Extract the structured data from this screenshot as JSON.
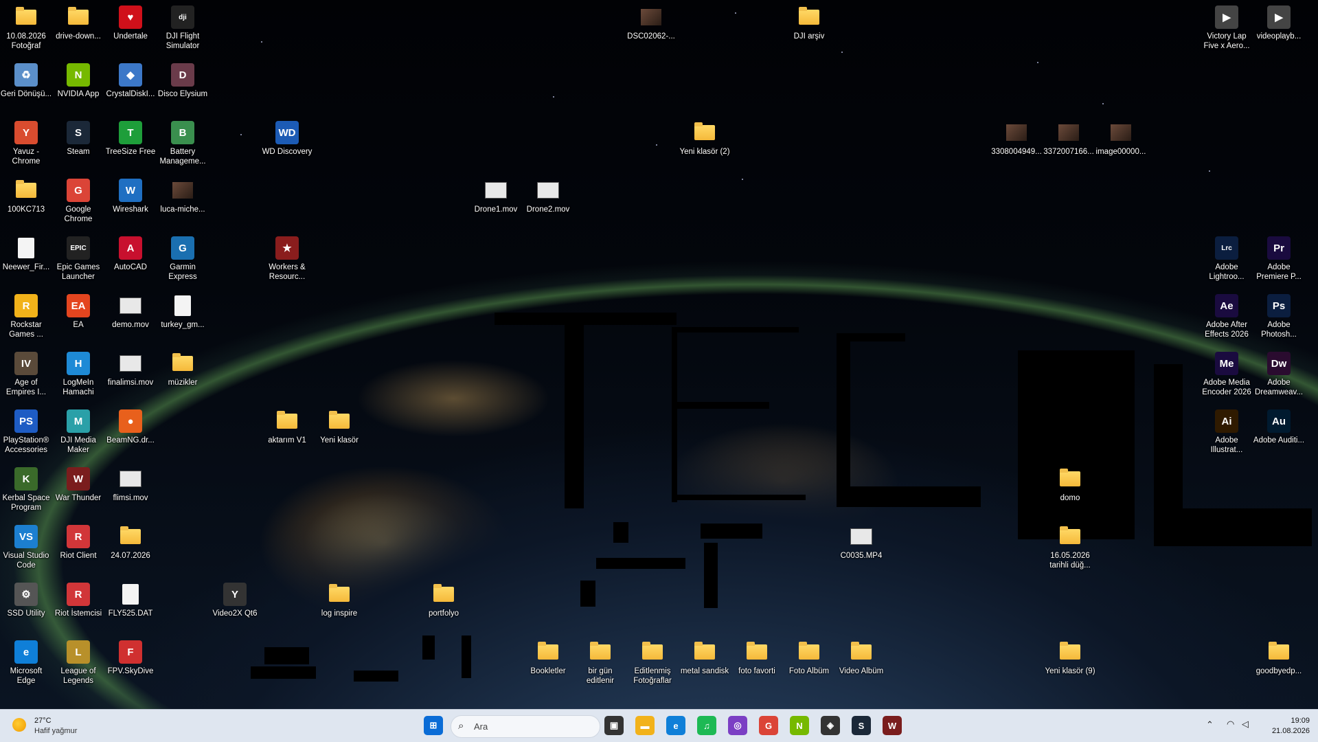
{
  "desktop_icons": [
    {
      "label": "10.08.2026 Fotoğraf",
      "kind": "folder"
    },
    {
      "label": "drive-down...",
      "kind": "folder"
    },
    {
      "label": "Undertale",
      "kind": "app",
      "glyph": "♥",
      "color": "#d0101a"
    },
    {
      "label": "DJI Flight Simulator",
      "kind": "app",
      "glyph": "dji",
      "color": "#222"
    },
    {
      "label": "DSC02062-...",
      "kind": "image"
    },
    {
      "label": "DJI arşiv",
      "kind": "folder"
    },
    {
      "label": "Victory Lap Five x Aero...",
      "kind": "app",
      "glyph": "▶",
      "color": "#444"
    },
    {
      "label": "videoplayb...",
      "kind": "app",
      "glyph": "▶",
      "color": "#444"
    },
    {
      "label": "Geri Dönüşü...",
      "kind": "app",
      "glyph": "♻",
      "color": "#5b8fc9"
    },
    {
      "label": "NVIDIA App",
      "kind": "app",
      "glyph": "N",
      "color": "#76b900"
    },
    {
      "label": "CrystalDiskI...",
      "kind": "app",
      "glyph": "◆",
      "color": "#3c78c8"
    },
    {
      "label": "Disco Elysium",
      "kind": "app",
      "glyph": "D",
      "color": "#6a3b4a"
    },
    {
      "label": "Yavuz - Chrome",
      "kind": "app",
      "glyph": "Y",
      "color": "#d94c2f"
    },
    {
      "label": "Steam",
      "kind": "app",
      "glyph": "S",
      "color": "#1b2838"
    },
    {
      "label": "TreeSize Free",
      "kind": "app",
      "glyph": "T",
      "color": "#1e9e3a"
    },
    {
      "label": "Battery Manageme...",
      "kind": "app",
      "glyph": "B",
      "color": "#3a8f4e"
    },
    {
      "label": "WD Discovery",
      "kind": "app",
      "glyph": "WD",
      "color": "#1c5bb5"
    },
    {
      "label": "Yeni klasör (2)",
      "kind": "folder"
    },
    {
      "label": "3308004949...",
      "kind": "image"
    },
    {
      "label": "3372007166...",
      "kind": "image"
    },
    {
      "label": "image00000...",
      "kind": "image"
    },
    {
      "label": "100KC713",
      "kind": "folder"
    },
    {
      "label": "Google Chrome",
      "kind": "app",
      "glyph": "G",
      "color": "#db4437"
    },
    {
      "label": "Wireshark",
      "kind": "app",
      "glyph": "W",
      "color": "#1f6fc2"
    },
    {
      "label": "luca-miche...",
      "kind": "image"
    },
    {
      "label": "Drone1.mov",
      "kind": "video"
    },
    {
      "label": "Drone2.mov",
      "kind": "video"
    },
    {
      "label": "Neewer_Fir...",
      "kind": "file"
    },
    {
      "label": "Epic Games Launcher",
      "kind": "app",
      "glyph": "EPIC",
      "color": "#222"
    },
    {
      "label": "AutoCAD",
      "kind": "app",
      "glyph": "A",
      "color": "#c8102e"
    },
    {
      "label": "Garmin Express",
      "kind": "app",
      "glyph": "G",
      "color": "#1a6fb0"
    },
    {
      "label": "Workers & Resourc...",
      "kind": "app",
      "glyph": "★",
      "color": "#8a1d1d"
    },
    {
      "label": "Adobe Lightroo...",
      "kind": "app",
      "glyph": "Lrc",
      "color": "#0b1e3f"
    },
    {
      "label": "Adobe Premiere P...",
      "kind": "app",
      "glyph": "Pr",
      "color": "#1a0b3f"
    },
    {
      "label": "Rockstar Games ...",
      "kind": "app",
      "glyph": "R",
      "color": "#f2b21a"
    },
    {
      "label": "EA",
      "kind": "app",
      "glyph": "EA",
      "color": "#e4451f"
    },
    {
      "label": "demo.mov",
      "kind": "video"
    },
    {
      "label": "turkey_gm...",
      "kind": "file"
    },
    {
      "label": "Adobe After Effects 2026",
      "kind": "app",
      "glyph": "Ae",
      "color": "#1a0b3f"
    },
    {
      "label": "Adobe Photosh...",
      "kind": "app",
      "glyph": "Ps",
      "color": "#0b1e3f"
    },
    {
      "label": "Age of Empires I...",
      "kind": "app",
      "glyph": "IV",
      "color": "#5a4a3a"
    },
    {
      "label": "LogMeIn Hamachi",
      "kind": "app",
      "glyph": "H",
      "color": "#1e8ad6"
    },
    {
      "label": "finalimsi.mov",
      "kind": "video"
    },
    {
      "label": "müzikler",
      "kind": "folder"
    },
    {
      "label": "Adobe Media Encoder 2026",
      "kind": "app",
      "glyph": "Me",
      "color": "#1a0b3f"
    },
    {
      "label": "Adobe Dreamweav...",
      "kind": "app",
      "glyph": "Dw",
      "color": "#2a0b2f"
    },
    {
      "label": "PlayStation® Accessories",
      "kind": "app",
      "glyph": "PS",
      "color": "#1e5cc4"
    },
    {
      "label": "DJI Media Maker",
      "kind": "app",
      "glyph": "M",
      "color": "#2aa0a8"
    },
    {
      "label": "BeamNG.dr...",
      "kind": "app",
      "glyph": "●",
      "color": "#e8601c"
    },
    {
      "label": "aktarım V1",
      "kind": "folder"
    },
    {
      "label": "Yeni klasör",
      "kind": "folder"
    },
    {
      "label": "Adobe Illustrat...",
      "kind": "app",
      "glyph": "Ai",
      "color": "#2f1a00"
    },
    {
      "label": "Adobe Auditi...",
      "kind": "app",
      "glyph": "Au",
      "color": "#001a2f"
    },
    {
      "label": "Kerbal Space Program",
      "kind": "app",
      "glyph": "K",
      "color": "#3a6a2a"
    },
    {
      "label": "War Thunder",
      "kind": "app",
      "glyph": "W",
      "color": "#7a1d1d"
    },
    {
      "label": "flimsi.mov",
      "kind": "video"
    },
    {
      "label": "domo",
      "kind": "folder"
    },
    {
      "label": "Visual Studio Code",
      "kind": "app",
      "glyph": "VS",
      "color": "#1c7fd0"
    },
    {
      "label": "Riot Client",
      "kind": "app",
      "glyph": "R",
      "color": "#d13639"
    },
    {
      "label": "24.07.2026",
      "kind": "folder"
    },
    {
      "label": "C0035.MP4",
      "kind": "video"
    },
    {
      "label": "16.05.2026 tarihli düğ...",
      "kind": "folder"
    },
    {
      "label": "SSD Utility",
      "kind": "app",
      "glyph": "⚙",
      "color": "#555"
    },
    {
      "label": "Riot İstemcisi",
      "kind": "app",
      "glyph": "R",
      "color": "#d13639"
    },
    {
      "label": "FLY525.DAT",
      "kind": "file"
    },
    {
      "label": "Video2X Qt6",
      "kind": "app",
      "glyph": "Y",
      "color": "#333"
    },
    {
      "label": "log inspire",
      "kind": "folder"
    },
    {
      "label": "portfolyo",
      "kind": "folder"
    },
    {
      "label": "Microsoft Edge",
      "kind": "app",
      "glyph": "e",
      "color": "#0f7fd8"
    },
    {
      "label": "League of Legends",
      "kind": "app",
      "glyph": "L",
      "color": "#b8902a"
    },
    {
      "label": "FPV.SkyDive",
      "kind": "app",
      "glyph": "F",
      "color": "#d03030"
    },
    {
      "label": "Bookletler",
      "kind": "folder"
    },
    {
      "label": "bir gün editlenir",
      "kind": "folder"
    },
    {
      "label": "Editlenmiş Fotoğraflar",
      "kind": "folder"
    },
    {
      "label": "metal sandisk",
      "kind": "folder"
    },
    {
      "label": "foto favorti",
      "kind": "folder"
    },
    {
      "label": "Foto Albüm",
      "kind": "folder"
    },
    {
      "label": "Video Albüm",
      "kind": "folder"
    },
    {
      "label": "Yeni klasör (9)",
      "kind": "folder"
    },
    {
      "label": "goodbyedp...",
      "kind": "folder"
    }
  ],
  "taskbar": {
    "weather": {
      "temp": "27°C",
      "desc": "Hafif yağmur"
    },
    "search_placeholder": "Ara",
    "clock": {
      "time": "19:09",
      "date": "21.08.2026"
    },
    "apps": [
      {
        "name": "start-button",
        "glyph": "⊞",
        "color": "#0a6cd6"
      },
      {
        "name": "task-view-button",
        "glyph": "▣",
        "color": "#333"
      },
      {
        "name": "file-explorer-button",
        "glyph": "▬",
        "color": "#f2b21a"
      },
      {
        "name": "edge-button",
        "glyph": "e",
        "color": "#0f7fd8"
      },
      {
        "name": "spotify-button",
        "glyph": "♫",
        "color": "#1db954"
      },
      {
        "name": "podcast-button",
        "glyph": "◎",
        "color": "#7b3fc4"
      },
      {
        "name": "chrome-button",
        "glyph": "G",
        "color": "#db4437"
      },
      {
        "name": "nvidia-button",
        "glyph": "N",
        "color": "#76b900"
      },
      {
        "name": "davinci-button",
        "glyph": "◈",
        "color": "#333"
      },
      {
        "name": "steam-button",
        "glyph": "S",
        "color": "#1b2838"
      },
      {
        "name": "warthunder-button",
        "glyph": "W",
        "color": "#7a1d1d"
      }
    ]
  }
}
